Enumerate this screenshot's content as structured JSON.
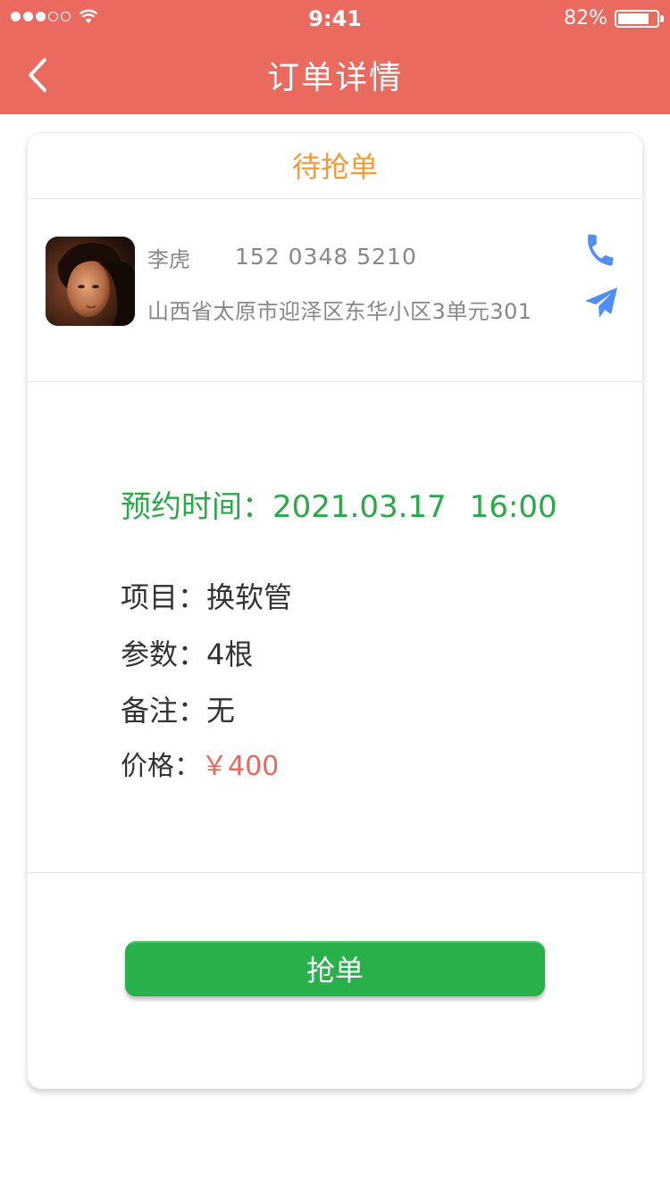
{
  "status_bar": {
    "time": "9:41",
    "battery_percent": "82%",
    "battery_level": 0.82,
    "signal_strength": 3,
    "signal_total": 5
  },
  "nav": {
    "title": "订单详情",
    "back_icon": "chevron-left-icon"
  },
  "order": {
    "status": "待抢单",
    "customer": {
      "name": "李虎",
      "phone": "152 0348 5210",
      "address": "山西省太原市迎泽区东华小区3单元301",
      "phone_icon": "phone-icon",
      "navigate_icon": "paper-plane-icon"
    },
    "appointment": {
      "label": "预约时间：",
      "date": "2021.03.17",
      "time": "16:00"
    },
    "details": {
      "project_label": "项目：",
      "project_value": "换软管",
      "params_label": "参数：",
      "params_value": "4根",
      "remark_label": "备注：",
      "remark_value": "无",
      "price_label": "价格：",
      "price_value": "￥400"
    },
    "grab_button_label": "抢单"
  },
  "colors": {
    "header_bg": "#ea6a60",
    "status_orange": "#f29b38",
    "appointment_green": "#2aa84a",
    "price_red": "#e76a62",
    "icon_blue": "#4f8ef7",
    "button_green": "#28b04a"
  }
}
